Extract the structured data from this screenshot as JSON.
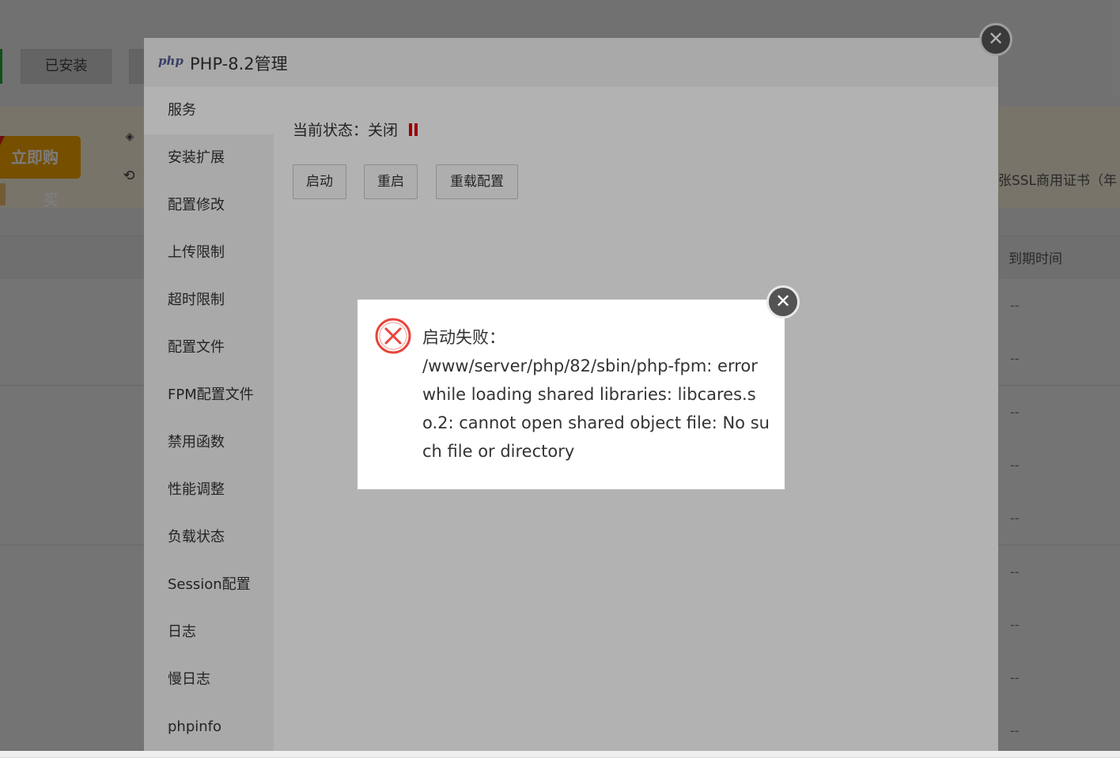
{
  "background": {
    "tabs": {
      "installed": "已安装"
    },
    "buy_button": "立即购买",
    "ssl_text": "张SSL商用证书（年",
    "table_head_expire": "到期时间",
    "row_placeholder": "--",
    "row_count": 9
  },
  "php_dialog": {
    "logo": "php",
    "title": "PHP-8.2管理",
    "sidebar": [
      {
        "label": "服务",
        "active": true
      },
      {
        "label": "安装扩展"
      },
      {
        "label": "配置修改"
      },
      {
        "label": "上传限制"
      },
      {
        "label": "超时限制"
      },
      {
        "label": "配置文件"
      },
      {
        "label": "FPM配置文件"
      },
      {
        "label": "禁用函数"
      },
      {
        "label": "性能调整"
      },
      {
        "label": "负载状态"
      },
      {
        "label": "Session配置"
      },
      {
        "label": "日志"
      },
      {
        "label": "慢日志"
      },
      {
        "label": "phpinfo"
      }
    ],
    "status_label": "当前状态：",
    "status_value": "关闭",
    "buttons": {
      "start": "启动",
      "restart": "重启",
      "reload": "重载配置"
    },
    "close_symbol": "✕"
  },
  "error_dialog": {
    "title": "启动失败：",
    "message": "/www/server/php/82/sbin/php-fpm: error while loading shared libraries: libcares.so.2: cannot open shared object file: No such file or directory",
    "close_symbol": "✕",
    "icon": "error-circle-x-icon",
    "icon_color": "#e8453c"
  }
}
